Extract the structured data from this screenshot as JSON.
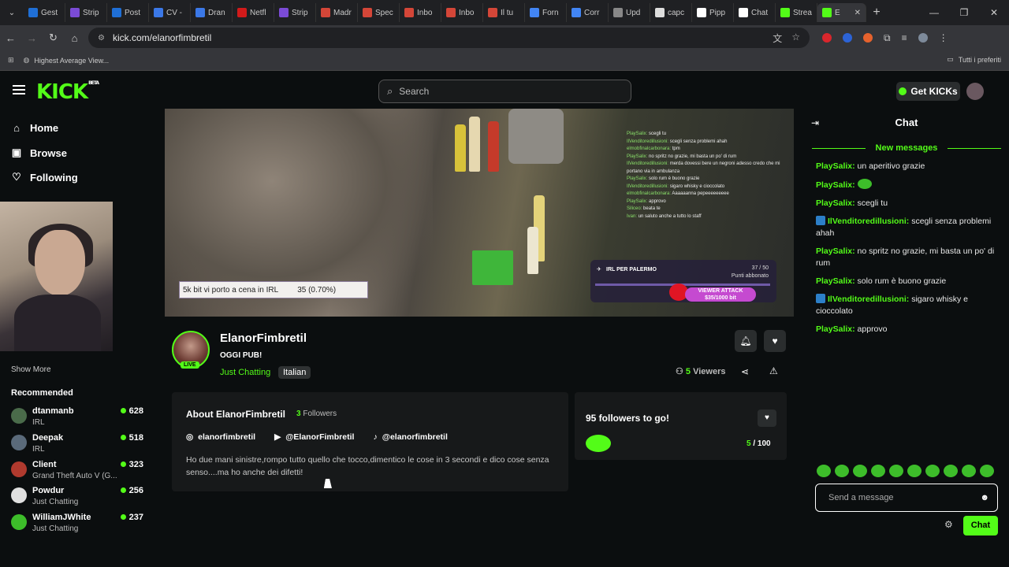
{
  "browser": {
    "tabs": [
      {
        "label": "Gest",
        "color": "#1f6fd6"
      },
      {
        "label": "Strip",
        "color": "#7b4bd6"
      },
      {
        "label": "Post",
        "color": "#1f6fd6"
      },
      {
        "label": "CV -",
        "color": "#3b78e7"
      },
      {
        "label": "Dran",
        "color": "#3b78e7"
      },
      {
        "label": "Netfl",
        "color": "#d11a1a"
      },
      {
        "label": "Strip",
        "color": "#7b4bd6"
      },
      {
        "label": "Madr",
        "color": "#d44638"
      },
      {
        "label": "Spec",
        "color": "#d44638"
      },
      {
        "label": "Inbo",
        "color": "#d44638"
      },
      {
        "label": "Inbo",
        "color": "#d44638"
      },
      {
        "label": "Il tu",
        "color": "#d44638"
      },
      {
        "label": "Forn",
        "color": "#4285f4"
      },
      {
        "label": "Corr",
        "color": "#4285f4"
      },
      {
        "label": "Upd",
        "color": "#888888"
      },
      {
        "label": "capc",
        "color": "#dddddd"
      },
      {
        "label": "Pipp",
        "color": "#ffffff"
      },
      {
        "label": "Chat",
        "color": "#ffffff"
      },
      {
        "label": "Strea",
        "color": "#53fc18"
      },
      {
        "label": "E",
        "color": "#53fc18",
        "active": true
      }
    ],
    "url": "kick.com/elanorfimbretil",
    "bookmark": "Highest Average View...",
    "bookmarks_folder": "Tutti i preferiti"
  },
  "header": {
    "logo": "KICK",
    "logo_beta": "BETA",
    "search_placeholder": "Search",
    "get_kicks": "Get KICKs"
  },
  "sidebar": {
    "nav": [
      {
        "label": "Home",
        "icon": "home-icon"
      },
      {
        "label": "Browse",
        "icon": "browse-icon"
      },
      {
        "label": "Following",
        "icon": "heart-icon"
      }
    ],
    "show_more": "Show More",
    "recommended_title": "Recommended",
    "recommended": [
      {
        "name": "dtanmanb",
        "category": "IRL",
        "viewers": "628",
        "color": "#4a6b4a"
      },
      {
        "name": "Deepak",
        "category": "IRL",
        "viewers": "518",
        "color": "#5a6a7a"
      },
      {
        "name": "Client",
        "category": "Grand Theft Auto V (G...",
        "viewers": "323",
        "color": "#b03a2e"
      },
      {
        "name": "Powdur",
        "category": "Just Chatting",
        "viewers": "256",
        "color": "#e0e0e0"
      },
      {
        "name": "WilliamJWhite",
        "category": "Just Chatting",
        "viewers": "237",
        "color": "#3dbd2a"
      }
    ]
  },
  "video": {
    "donation_text": "5k bit vi porto a cena in IRL",
    "donation_value": "35 (0.70%)",
    "irl_title": "IRL PER PALERMO",
    "irl_count": "37 / 50",
    "irl_sub": "Punti abbonato",
    "viewer_attack": "VIEWER ATTACK",
    "viewer_attack_value": "$35/1000 bit",
    "overlay_chat": [
      {
        "user": "PlaySalix:",
        "text": "scegli tu"
      },
      {
        "user": "IlVenditoredillusioni:",
        "text": "scegli senza problemi ahah"
      },
      {
        "user": "elmobfinalcarbonara:",
        "text": "tpm"
      },
      {
        "user": "PlaySalix:",
        "text": "no spritz no grazie, mi basta un po' di rum"
      },
      {
        "user": "IlVenditoredillusioni:",
        "text": "merda dovessi bere un negroni adesso credo che mi portano via in ambulanza"
      },
      {
        "user": "PlaySalix:",
        "text": "solo rum è buono grazie"
      },
      {
        "user": "IlVenditoredillusioni:",
        "text": "sigaro whisky e cioccolato"
      },
      {
        "user": "elmobfinalcarbonara:",
        "text": "Aaaaaanna pepeeeeeeeee"
      },
      {
        "user": "PlaySalix:",
        "text": "approvo"
      },
      {
        "user": "Siliceo:",
        "text": "beata te"
      },
      {
        "user": "Ivan:",
        "text": "un saluto anche a tutto lo staff"
      }
    ]
  },
  "channel": {
    "name": "ElanorFimbretil",
    "live": "LIVE",
    "title": "OGGI PUB!",
    "category": "Just Chatting",
    "language": "Italian",
    "viewers_count": "5",
    "viewers_label": "Viewers",
    "about_title": "About ElanorFimbretil",
    "followers_count": "3",
    "followers_label": "Followers",
    "socials": [
      {
        "icon": "instagram-icon",
        "glyph": "◎",
        "label": "elanorfimbretil"
      },
      {
        "icon": "youtube-icon",
        "glyph": "▶",
        "label": "@ElanorFimbretil"
      },
      {
        "icon": "tiktok-icon",
        "glyph": "♪",
        "label": "@elanorfimbretil"
      }
    ],
    "bio": "Ho due mani sinistre,rompo tutto quello che tocco,dimentico le cose in 3 secondi e dico cose senza senso....ma ho anche dei difetti!",
    "goal_title": "95 followers to go!",
    "goal_current": "5",
    "goal_total": "/ 100"
  },
  "chat": {
    "title": "Chat",
    "new_messages": "New messages",
    "messages": [
      {
        "user": "PlaySalix:",
        "text": "un aperitivo grazie",
        "badge": false
      },
      {
        "user": "PlaySalix:",
        "text": "",
        "badge": false,
        "emote": true
      },
      {
        "user": "PlaySalix:",
        "text": "scegli tu",
        "badge": false
      },
      {
        "user": "IlVenditoredillusioni:",
        "text": "scegli senza problemi ahah",
        "badge": true
      },
      {
        "user": "PlaySalix:",
        "text": "no spritz no grazie, mi basta un po' di rum",
        "badge": false
      },
      {
        "user": "PlaySalix:",
        "text": "solo rum è buono grazie",
        "badge": false
      },
      {
        "user": "IlVenditoredillusioni:",
        "text": "sigaro whisky e cioccolato",
        "badge": true
      },
      {
        "user": "PlaySalix:",
        "text": "approvo",
        "badge": false
      }
    ],
    "input_placeholder": "Send a message",
    "send_label": "Chat"
  },
  "colors": {
    "accent": "#53fc18",
    "background": "#0b0e0f",
    "panel": "#17191a"
  }
}
